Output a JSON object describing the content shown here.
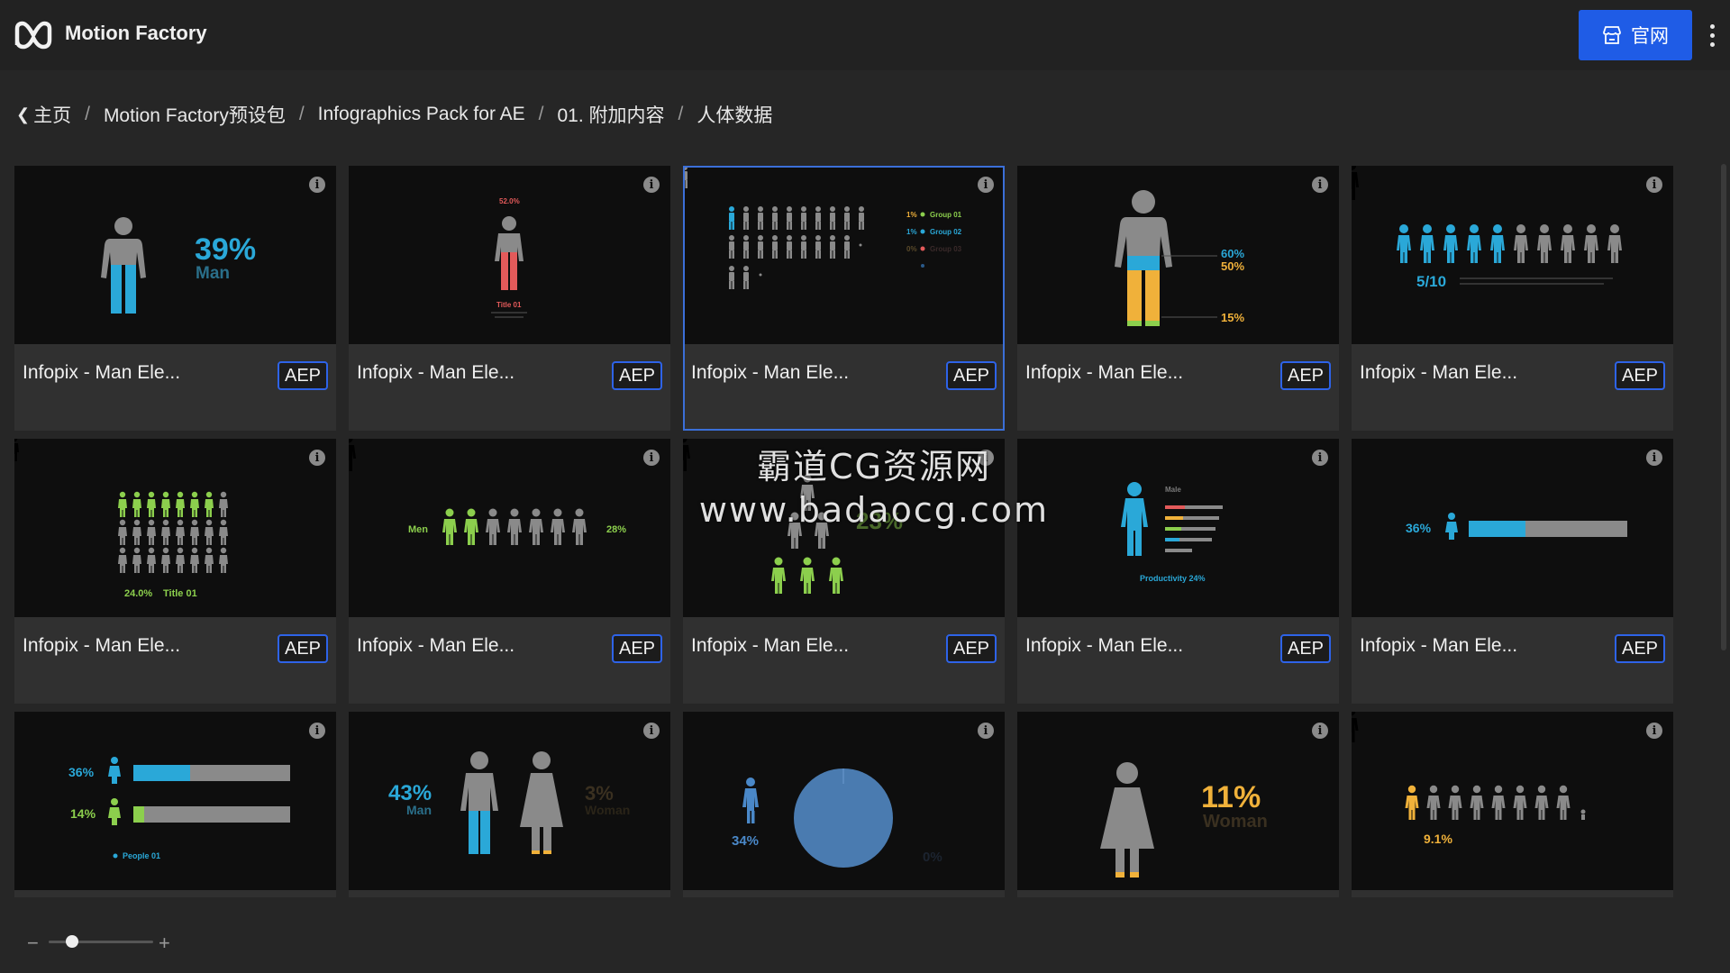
{
  "header": {
    "brand": "Motion Factory",
    "site_button": "官网"
  },
  "breadcrumb": [
    "主页",
    "Motion Factory预设包",
    "Infographics Pack for AE",
    "01. 附加内容",
    "人体数据"
  ],
  "cards": [
    {
      "title": "Infopix - Man Ele...",
      "badge": "AEP",
      "preview": {
        "pct": "39%",
        "label": "Man"
      }
    },
    {
      "title": "Infopix - Man Ele...",
      "badge": "AEP",
      "preview": {
        "pct": "52.0%",
        "label": "Title 01"
      }
    },
    {
      "title": "Infopix - Man Ele...",
      "badge": "AEP",
      "preview": {
        "l1": "1%",
        "g1": "Group 01",
        "l2": "1%",
        "g2": "Group 02",
        "l3": "0%",
        "g3": "Group 03"
      }
    },
    {
      "title": "Infopix - Man Ele...",
      "badge": "AEP",
      "preview": {
        "a": "60%",
        "b": "50%",
        "c": "15%"
      }
    },
    {
      "title": "Infopix - Man Ele...",
      "badge": "AEP",
      "preview": {
        "pct": "5/10"
      }
    },
    {
      "title": "Infopix - Man Ele...",
      "badge": "AEP",
      "preview": {
        "pct": "24.0%",
        "label": "Title 01"
      }
    },
    {
      "title": "Infopix - Man Ele...",
      "badge": "AEP",
      "preview": {
        "label": "Men",
        "pct": "28%"
      }
    },
    {
      "title": "Infopix - Man Ele...",
      "badge": "AEP",
      "preview": {
        "pct": "23%"
      }
    },
    {
      "title": "Infopix - Man Ele...",
      "badge": "AEP",
      "preview": {
        "label": "Male",
        "pct": "Productivity 24%"
      }
    },
    {
      "title": "Infopix - Man Ele...",
      "badge": "AEP",
      "preview": {
        "pct": "36%"
      }
    },
    {
      "title": "",
      "badge": "",
      "preview": {
        "a": "36%",
        "b": "14%",
        "c": "People 01"
      }
    },
    {
      "title": "",
      "badge": "",
      "preview": {
        "a": "43%",
        "al": "Man",
        "b": "3%",
        "bl": "Woman"
      }
    },
    {
      "title": "",
      "badge": "",
      "preview": {
        "a": "34%",
        "b": "0%"
      }
    },
    {
      "title": "",
      "badge": "",
      "preview": {
        "pct": "11%",
        "label": "Woman"
      }
    },
    {
      "title": "",
      "badge": "",
      "preview": {
        "pct": "9.1%"
      }
    }
  ],
  "watermark": {
    "line1": "霸道CG资源网",
    "line2": "www.badaocg.com"
  },
  "colors": {
    "accent": "#1f5ce6",
    "blue": "#2aa8d8",
    "green": "#8ccf4d",
    "red": "#e35a5a",
    "orange": "#f0b13a",
    "gray": "#8a8a8a"
  }
}
